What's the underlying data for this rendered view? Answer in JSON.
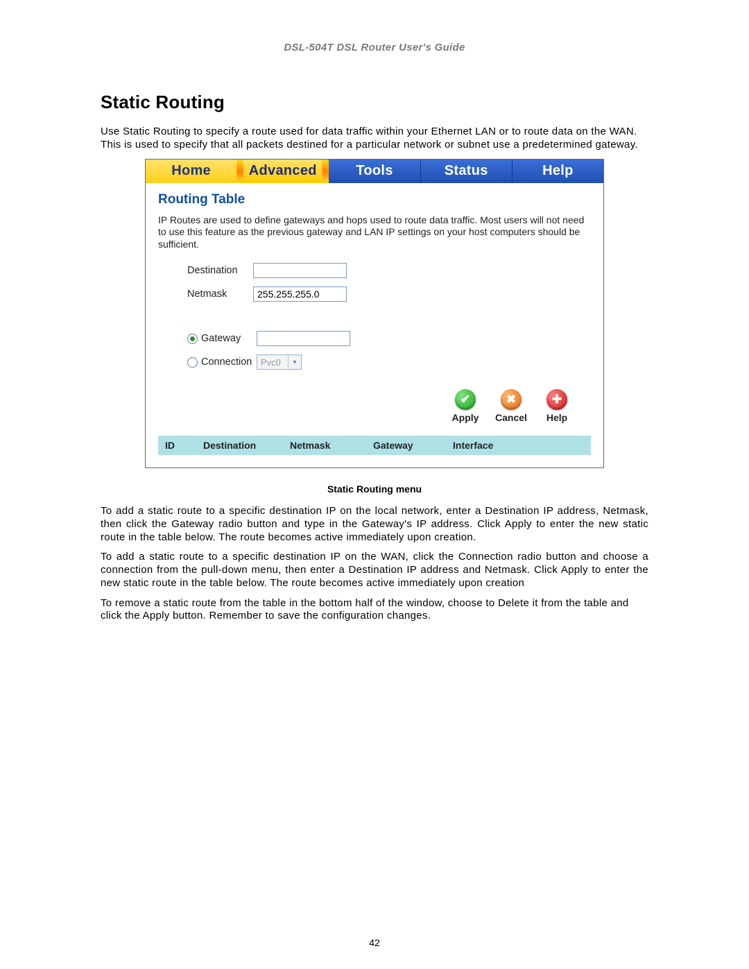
{
  "doc": {
    "header": "DSL-504T DSL Router User's Guide",
    "title": "Static Routing",
    "intro": "Use Static Routing to specify a route used for data traffic within your Ethernet LAN or to route data on the WAN. This is used to specify that all packets destined for a particular network or subnet use a predetermined gateway.",
    "caption": "Static Routing menu",
    "p1": "To add a static route to a specific destination IP on the local network, enter a Destination IP address, Netmask, then click the Gateway radio button and type in the Gateway's IP address. Click Apply to enter the new static route in the table below. The route becomes active immediately upon creation.",
    "p2": "To add a static route to a specific destination IP on the WAN, click the Connection radio button and choose a connection from the pull-down menu, then enter a Destination IP address and Netmask. Click Apply to enter the new static route in the table below. The route becomes active immediately upon creation",
    "p3": "To remove a static route from the table in the bottom half of the window, choose to Delete it from the table and click the Apply button. Remember to save the configuration changes.",
    "page_number": "42"
  },
  "tabs": {
    "home": "Home",
    "advanced": "Advanced",
    "tools": "Tools",
    "status": "Status",
    "help": "Help"
  },
  "panel": {
    "title": "Routing Table",
    "desc": "IP Routes are used to define gateways and hops used to route data traffic. Most users will not need to use this feature as the previous gateway and LAN IP settings on your host computers should be sufficient."
  },
  "form": {
    "destination_label": "Destination",
    "destination_value": "",
    "netmask_label": "Netmask",
    "netmask_value": "255.255.255.0",
    "gateway_label": "Gateway",
    "gateway_value": "",
    "connection_label": "Connection",
    "connection_selected": "Pvc0"
  },
  "buttons": {
    "apply": "Apply",
    "cancel": "Cancel",
    "help": "Help"
  },
  "table": {
    "headers": {
      "id": "ID",
      "destination": "Destination",
      "netmask": "Netmask",
      "gateway": "Gateway",
      "interface": "Interface"
    }
  }
}
